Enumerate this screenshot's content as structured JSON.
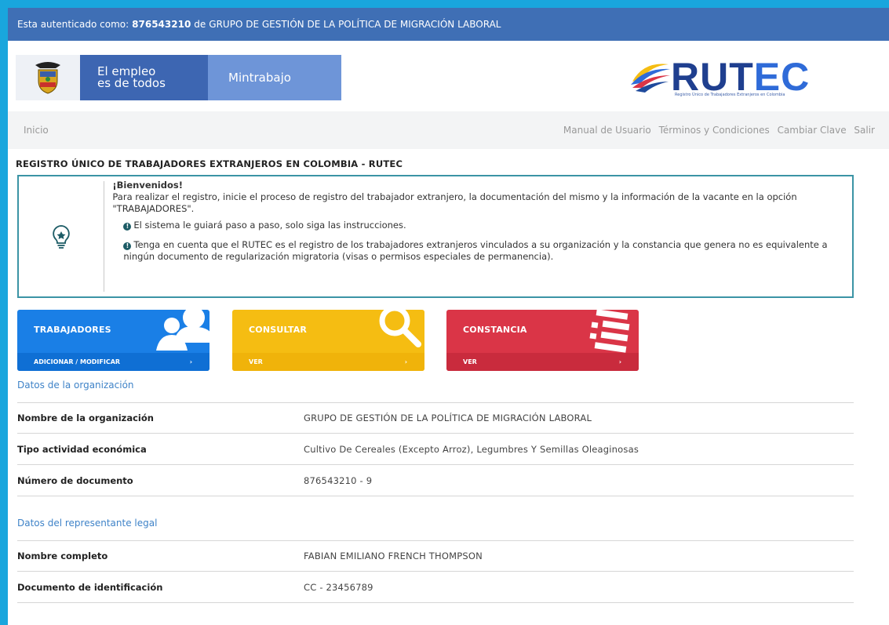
{
  "auth": {
    "prefix": "Esta autenticado como:",
    "user_id": "876543210",
    "connector": "de",
    "organization": "GRUPO DE GESTIÓN DE LA POLÍTICA DE MIGRACIÓN LABORAL"
  },
  "header": {
    "slogan_line1": "El empleo",
    "slogan_line2": "es de todos",
    "ministry": "Mintrabajo",
    "brand_part1": "RUT",
    "brand_part2": "EC",
    "brand_subtitle": "Registro Único de Trabajadores Extranjeros en Colombia"
  },
  "nav": {
    "home": "Inicio",
    "manual": "Manual de Usuario",
    "terms": "Términos y Condiciones",
    "change_password": "Cambiar Clave",
    "logout": "Salir"
  },
  "page_title": "REGISTRO ÚNICO DE TRABAJADORES EXTRANJEROS EN COLOMBIA - RUTEC",
  "welcome": {
    "title": "¡Bienvenidos!",
    "intro": "Para realizar el registro, inicie el proceso de registro del trabajador extranjero, la documentación del mismo y la información de la vacante en la opción \"TRABAJADORES\".",
    "note1": "El sistema le guiará paso a paso, solo siga las instrucciones.",
    "note2": "Tenga en cuenta que el RUTEC es el registro de los trabajadores extranjeros vinculados a su organización y la constancia que genera no es equivalente a ningún documento de regularización migratoria (visas o permisos especiales de permanencia)."
  },
  "tiles": [
    {
      "title": "TRABAJADORES",
      "action": "ADICIONAR / MODIFICAR",
      "arrow": "›"
    },
    {
      "title": "CONSULTAR",
      "action": "VER",
      "arrow": "›"
    },
    {
      "title": "CONSTANCIA",
      "action": "VER",
      "arrow": "›"
    }
  ],
  "organization": {
    "section_title": "Datos de la organización",
    "rows": [
      {
        "label": "Nombre de la organización",
        "value": "GRUPO DE GESTIÓN DE LA POLÍTICA DE MIGRACIÓN LABORAL"
      },
      {
        "label": "Tipo actividad económica",
        "value": "Cultivo De Cereales (Excepto Arroz), Legumbres Y Semillas Oleaginosas"
      },
      {
        "label": "Número de documento",
        "value": "876543210 - 9"
      }
    ]
  },
  "legal_rep": {
    "section_title": "Datos del representante legal",
    "rows": [
      {
        "label": "Nombre completo",
        "value": "FABIAN EMILIANO FRENCH THOMPSON"
      },
      {
        "label": "Documento de identificación",
        "value": "CC - 23456789"
      }
    ]
  },
  "colors": {
    "auth_bar": "#3f6fb5",
    "tile_blue": "#1a7fe6",
    "tile_yellow": "#f5bd12",
    "tile_red": "#da3547",
    "accent_link": "#3f83c8",
    "frame": "#19a6dd"
  },
  "icons": [
    "coat-of-arms-icon",
    "rutec-swirl-icon",
    "lightbulb-icon",
    "info-icon",
    "users-icon",
    "search-icon",
    "document-icon",
    "chevron-right-icon"
  ]
}
